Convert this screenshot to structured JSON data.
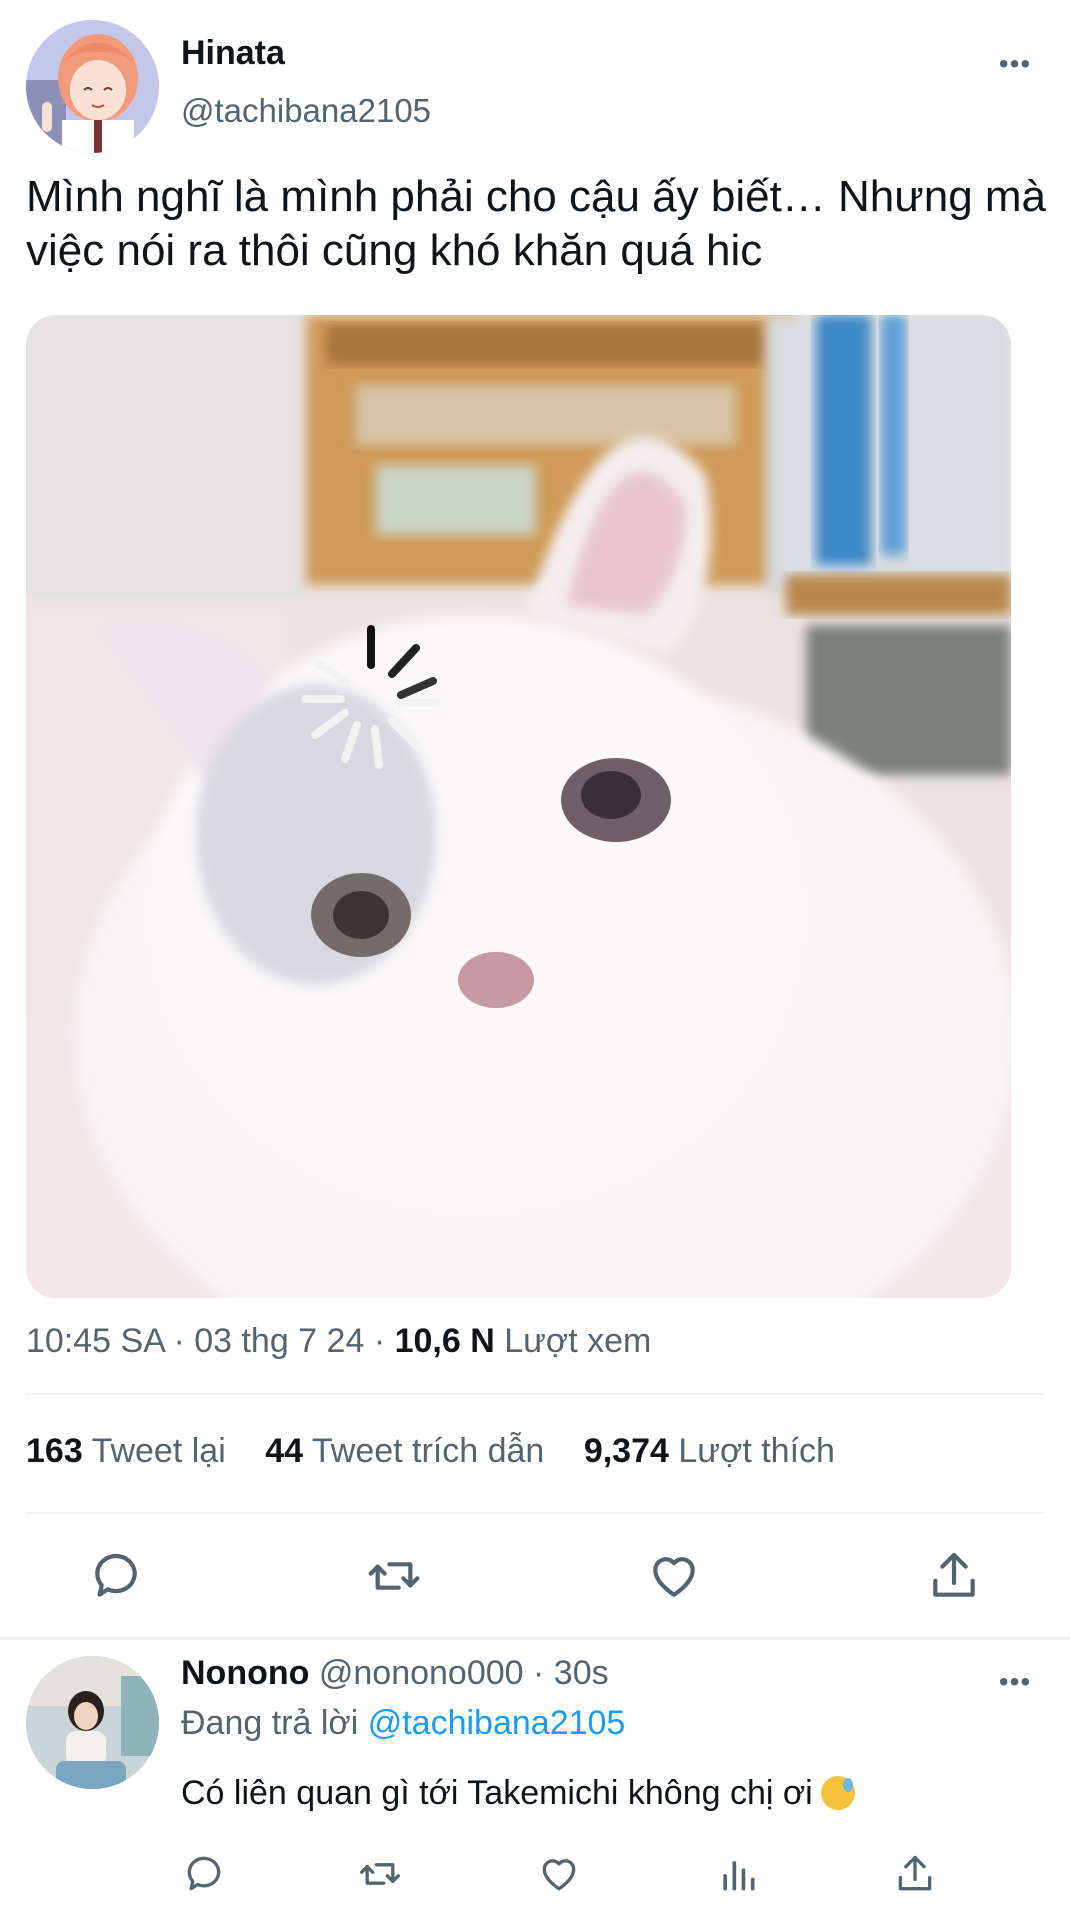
{
  "tweet": {
    "author_name": "Hinata",
    "author_handle": "@tachibana2105",
    "more_icon": "more-horizontal-icon",
    "text": "Mình nghĩ là mình phải cho cậu ấy biết… Nhưng mà việc nói ra thôi cũng khó khăn quá hic",
    "time": "10:45 SA · 03 thg 7 24 ·",
    "views_count": "10,6 N",
    "views_label": "Lượt xem",
    "stats": {
      "retweets_count": "163",
      "retweets_label": "Tweet lại",
      "quotes_count": "44",
      "quotes_label": "Tweet trích dẫn",
      "likes_count": "9,374",
      "likes_label": "Lượt thích"
    },
    "actions": [
      "reply-icon",
      "retweet-icon",
      "like-icon",
      "share-icon"
    ]
  },
  "reply": {
    "author_name": "Nonono",
    "author_handle": "@nonono000",
    "age": "· 30s",
    "replying_prefix": "Đang trả lời",
    "replying_to": "@tachibana2105",
    "text": "Có liên quan gì tới Takemichi không chị ơi",
    "emoji": "sweat-face-emoji",
    "actions": [
      "reply-icon",
      "retweet-icon",
      "like-icon",
      "analytics-icon",
      "share-icon"
    ]
  },
  "colors": {
    "text": "#0f1419",
    "secondary": "#536471",
    "link": "#1d9bf0",
    "divider": "#eff3f4"
  }
}
